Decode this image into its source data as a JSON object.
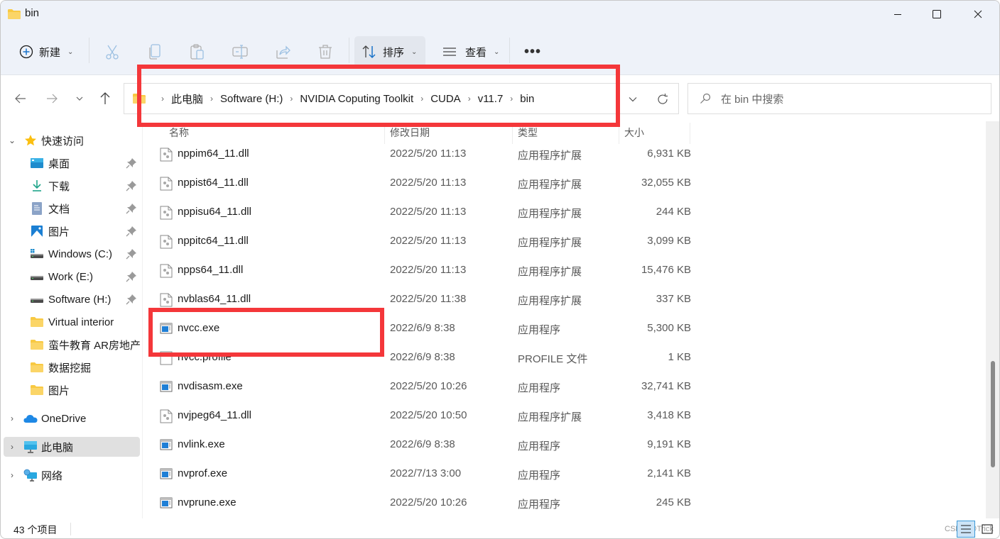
{
  "window": {
    "title": "bin",
    "minimize_label": "minimize",
    "maximize_label": "maximize",
    "close_label": "close"
  },
  "commandbar": {
    "new_label": "新建",
    "sort_label": "排序",
    "view_label": "查看",
    "more_label": "•••",
    "tools": [
      "cut",
      "copy",
      "paste",
      "rename",
      "share",
      "delete"
    ]
  },
  "address": {
    "crumbs": [
      "此电脑",
      "Software (H:)",
      "NVIDIA Coputing Toolkit",
      "CUDA",
      "v11.7",
      "bin"
    ]
  },
  "search": {
    "placeholder": "在 bin 中搜索"
  },
  "sidebar": {
    "quick_access": "快速访问",
    "items": [
      {
        "label": "桌面",
        "icon": "desktop-icon",
        "pinned": true
      },
      {
        "label": "下载",
        "icon": "download-icon",
        "pinned": true
      },
      {
        "label": "文档",
        "icon": "documents-icon",
        "pinned": true
      },
      {
        "label": "图片",
        "icon": "pictures-icon",
        "pinned": true
      },
      {
        "label": "Windows (C:)",
        "icon": "drive-icon",
        "pinned": true
      },
      {
        "label": "Work (E:)",
        "icon": "drive-icon",
        "pinned": true
      },
      {
        "label": "Software (H:)",
        "icon": "drive-icon",
        "pinned": true
      },
      {
        "label": "Virtual interior",
        "icon": "folder-icon",
        "pinned": false
      },
      {
        "label": "蛮牛教育 AR房地产",
        "icon": "folder-icon",
        "pinned": false
      },
      {
        "label": "数据挖掘",
        "icon": "folder-icon",
        "pinned": false
      },
      {
        "label": "图片",
        "icon": "folder-icon",
        "pinned": false
      }
    ],
    "onedrive": "OneDrive",
    "this_pc": "此电脑",
    "network": "网络"
  },
  "columns": {
    "name": "名称",
    "date": "修改日期",
    "type": "类型",
    "size": "大小"
  },
  "files": [
    {
      "name": "nppim64_11.dll",
      "date": "2022/5/20 11:13",
      "type": "应用程序扩展",
      "size": "6,931 KB",
      "kind": "dll"
    },
    {
      "name": "nppist64_11.dll",
      "date": "2022/5/20 11:13",
      "type": "应用程序扩展",
      "size": "32,055 KB",
      "kind": "dll"
    },
    {
      "name": "nppisu64_11.dll",
      "date": "2022/5/20 11:13",
      "type": "应用程序扩展",
      "size": "244 KB",
      "kind": "dll"
    },
    {
      "name": "nppitc64_11.dll",
      "date": "2022/5/20 11:13",
      "type": "应用程序扩展",
      "size": "3,099 KB",
      "kind": "dll"
    },
    {
      "name": "npps64_11.dll",
      "date": "2022/5/20 11:13",
      "type": "应用程序扩展",
      "size": "15,476 KB",
      "kind": "dll"
    },
    {
      "name": "nvblas64_11.dll",
      "date": "2022/5/20 11:38",
      "type": "应用程序扩展",
      "size": "337 KB",
      "kind": "dll"
    },
    {
      "name": "nvcc.exe",
      "date": "2022/6/9 8:38",
      "type": "应用程序",
      "size": "5,300 KB",
      "kind": "exe"
    },
    {
      "name": "nvcc.profile",
      "date": "2022/6/9 8:38",
      "type": "PROFILE 文件",
      "size": "1 KB",
      "kind": "file"
    },
    {
      "name": "nvdisasm.exe",
      "date": "2022/5/20 10:26",
      "type": "应用程序",
      "size": "32,741 KB",
      "kind": "exe"
    },
    {
      "name": "nvjpeg64_11.dll",
      "date": "2022/5/20 10:50",
      "type": "应用程序扩展",
      "size": "3,418 KB",
      "kind": "dll"
    },
    {
      "name": "nvlink.exe",
      "date": "2022/6/9 8:38",
      "type": "应用程序",
      "size": "9,191 KB",
      "kind": "exe"
    },
    {
      "name": "nvprof.exe",
      "date": "2022/7/13 3:00",
      "type": "应用程序",
      "size": "2,141 KB",
      "kind": "exe"
    },
    {
      "name": "nvprune.exe",
      "date": "2022/5/20 10:26",
      "type": "应用程序",
      "size": "245 KB",
      "kind": "exe"
    }
  ],
  "status": {
    "item_count": "43 个项目",
    "watermark": "CSDN @Trick"
  },
  "colors": {
    "annotation": "#f4373a",
    "chrome_bg": "#eef2f9",
    "selected_nav": "#e0e0e0"
  }
}
